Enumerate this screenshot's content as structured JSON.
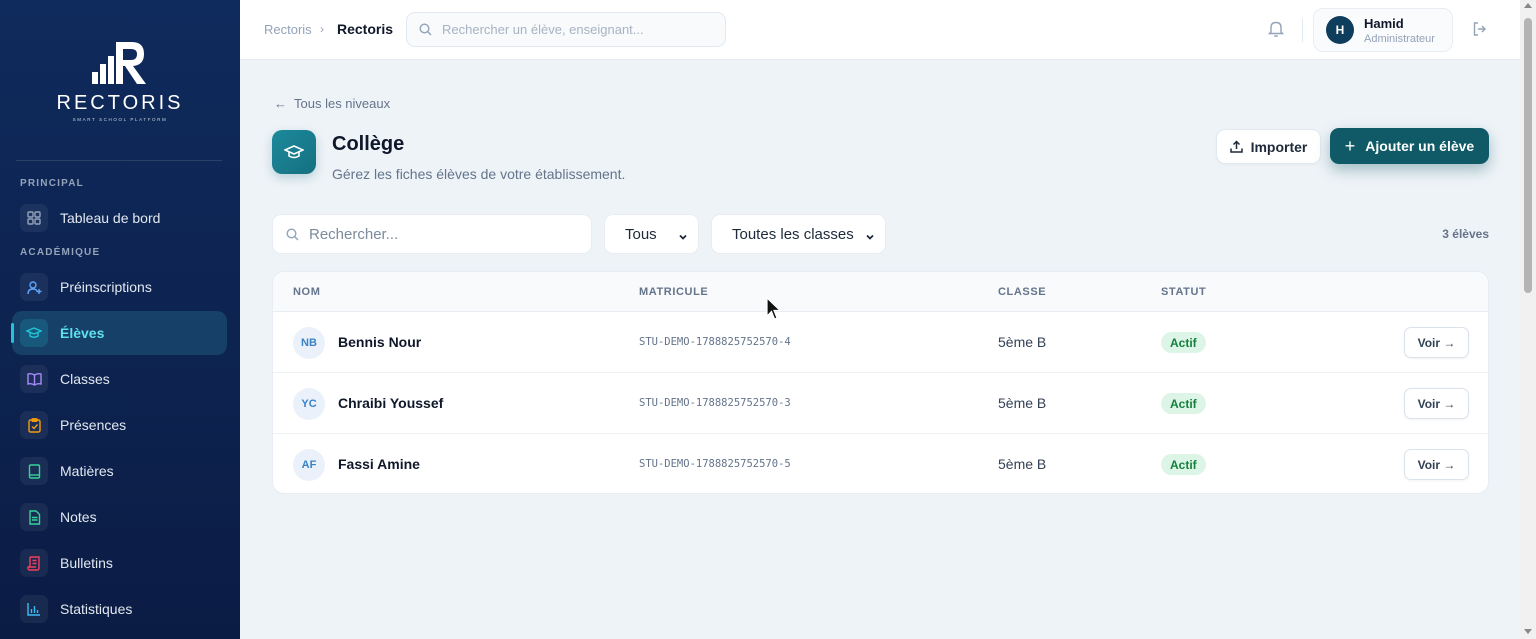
{
  "sidebar": {
    "logo_text": "RECTORIS",
    "logo_sub": "SMART SCHOOL PLATFORM",
    "sections": {
      "principal": "PRINCIPAL",
      "academique": "ACADÉMIQUE"
    },
    "items": [
      {
        "label": "Tableau de bord",
        "icon": "grid-icon",
        "color": "#94a3b8"
      },
      {
        "label": "Préinscriptions",
        "icon": "user-plus-icon",
        "color": "#60a5fa"
      },
      {
        "label": "Élèves",
        "icon": "graduation-cap-icon",
        "color": "#22c5d8",
        "active": true
      },
      {
        "label": "Classes",
        "icon": "book-open-icon",
        "color": "#a78bfa"
      },
      {
        "label": "Présences",
        "icon": "clipboard-check-icon",
        "color": "#f59e0b"
      },
      {
        "label": "Matières",
        "icon": "book-icon",
        "color": "#34d399"
      },
      {
        "label": "Notes",
        "icon": "file-text-icon",
        "color": "#34d399"
      },
      {
        "label": "Bulletins",
        "icon": "scroll-icon",
        "color": "#f43f5e"
      },
      {
        "label": "Statistiques",
        "icon": "bar-chart-icon",
        "color": "#38bdf8"
      }
    ]
  },
  "topbar": {
    "breadcrumb_root": "Rectoris",
    "breadcrumb_current": "Rectoris",
    "search_placeholder": "Rechercher un élève, enseignant...",
    "user": {
      "initial": "H",
      "name": "Hamid",
      "role": "Administrateur"
    }
  },
  "page": {
    "back_label": "Tous les niveaux",
    "title": "Collège",
    "subtitle": "Gérez les fiches élèves de votre établissement.",
    "import_label": "Importer",
    "add_label": "Ajouter un élève"
  },
  "filters": {
    "search_placeholder": "Rechercher...",
    "status_value": "Tous",
    "class_value": "Toutes les classes",
    "count": "3 élèves"
  },
  "table": {
    "columns": [
      "NOM",
      "MATRICULE",
      "CLASSE",
      "STATUT"
    ],
    "rows": [
      {
        "initials": "NB",
        "name": "Bennis Nour",
        "matricule": "STU-DEMO-1788825752570-4",
        "classe": "5ème B",
        "statut": "Actif",
        "action": "Voir →"
      },
      {
        "initials": "YC",
        "name": "Chraibi Youssef",
        "matricule": "STU-DEMO-1788825752570-3",
        "classe": "5ème B",
        "statut": "Actif",
        "action": "Voir →"
      },
      {
        "initials": "AF",
        "name": "Fassi Amine",
        "matricule": "STU-DEMO-1788825752570-5",
        "classe": "5ème B",
        "statut": "Actif",
        "action": "Voir →"
      }
    ]
  },
  "colors": {
    "sidebar_bg": "#0f2a5c",
    "accent": "#0f5a66",
    "active_text": "#5ee0ee",
    "badge_bg": "#dcf5e7",
    "badge_text": "#15803d"
  }
}
